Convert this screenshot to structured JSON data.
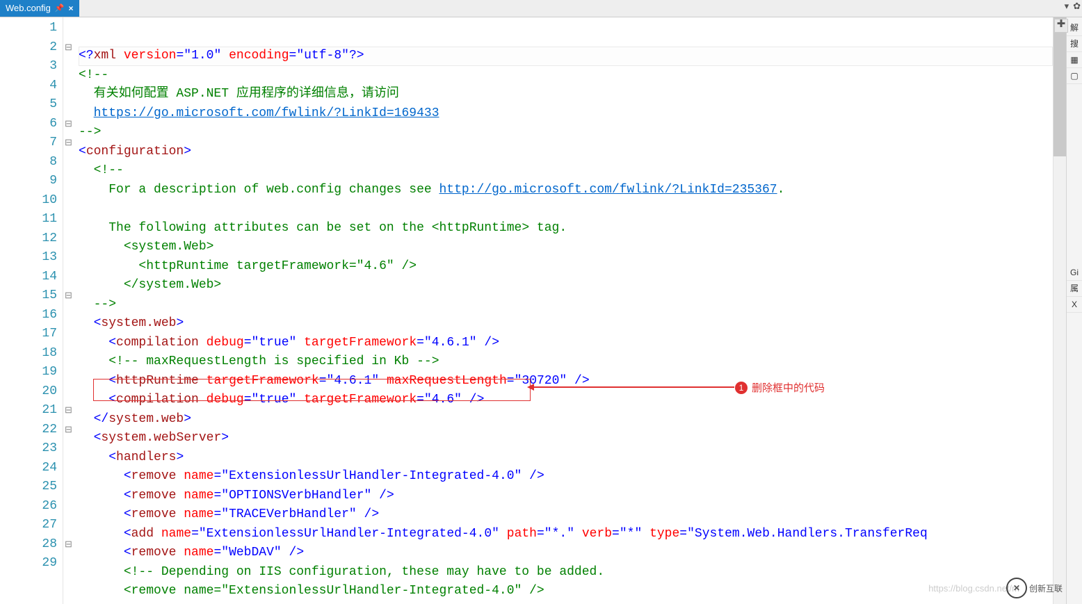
{
  "tab": {
    "title": "Web.config",
    "pin_glyph": "📌",
    "close_glyph": "×"
  },
  "sidebar_labels": {
    "solution": "解",
    "search": "搜",
    "git": "Gi",
    "prop": "属",
    "xml": "X"
  },
  "annotation": {
    "badge": "1",
    "text": "删除框中的代码"
  },
  "watermark": "https://blog.csdn.net/m",
  "logo_text": "创新互联",
  "lines": [
    {
      "n": 1,
      "fold": "",
      "html": "<span class='cm-punct'>&lt;?</span><span class='cm-name'>xml</span> <span class='cm-attr'>version</span><span class='cm-punct'>=</span><span class='cm-str'>\"1.0\"</span> <span class='cm-attr'>encoding</span><span class='cm-punct'>=</span><span class='cm-str'>\"utf-8\"</span><span class='cm-punct'>?&gt;</span>",
      "cls": "cursor-line"
    },
    {
      "n": 2,
      "fold": "⊟",
      "html": "<span class='cm-comment'>&lt;!--</span>"
    },
    {
      "n": 3,
      "fold": "",
      "html": "  <span class='cm-comment'>有关如何配置 ASP.NET 应用程序的详细信息，请访问</span>"
    },
    {
      "n": 4,
      "fold": "",
      "html": "  <span class='cm-comment cm-link'>https://go.microsoft.com/fwlink/?LinkId=169433</span>"
    },
    {
      "n": 5,
      "fold": "",
      "html": "<span class='cm-comment'>--&gt;</span>"
    },
    {
      "n": 6,
      "fold": "⊟",
      "html": "<span class='cm-punct'>&lt;</span><span class='cm-name'>configuration</span><span class='cm-punct'>&gt;</span>"
    },
    {
      "n": 7,
      "fold": "⊟",
      "html": "  <span class='cm-comment'>&lt;!--</span>"
    },
    {
      "n": 8,
      "fold": "",
      "html": "    <span class='cm-comment'>For a description of web.config changes see </span><span class='cm-comment cm-link'>http://go.microsoft.com/fwlink/?LinkId=235367</span><span class='cm-comment'>.</span>"
    },
    {
      "n": 9,
      "fold": "",
      "html": ""
    },
    {
      "n": 10,
      "fold": "",
      "html": "    <span class='cm-comment'>The following attributes can be set on the &lt;httpRuntime&gt; tag.</span>"
    },
    {
      "n": 11,
      "fold": "",
      "html": "      <span class='cm-comment'>&lt;system.Web&gt;</span>"
    },
    {
      "n": 12,
      "fold": "",
      "html": "        <span class='cm-comment'>&lt;httpRuntime targetFramework=\"4.6\" /&gt;</span>"
    },
    {
      "n": 13,
      "fold": "",
      "html": "      <span class='cm-comment'>&lt;/system.Web&gt;</span>"
    },
    {
      "n": 14,
      "fold": "",
      "html": "  <span class='cm-comment'>--&gt;</span>"
    },
    {
      "n": 15,
      "fold": "⊟",
      "html": "  <span class='cm-punct'>&lt;</span><span class='cm-name'>system.web</span><span class='cm-punct'>&gt;</span>"
    },
    {
      "n": 16,
      "fold": "",
      "html": "    <span class='cm-punct'>&lt;</span><span class='cm-name'>compilation</span> <span class='cm-attr'>debug</span><span class='cm-punct'>=</span><span class='cm-str'>\"true\"</span> <span class='cm-attr'>targetFramework</span><span class='cm-punct'>=</span><span class='cm-str'>\"4.6.1\"</span> <span class='cm-punct'>/&gt;</span>"
    },
    {
      "n": 17,
      "fold": "",
      "html": "    <span class='cm-comment'>&lt;!-- maxRequestLength is specified in Kb --&gt;</span>"
    },
    {
      "n": 18,
      "fold": "",
      "html": "    <span class='cm-punct'>&lt;</span><span class='cm-name'>httpRuntime</span> <span class='cm-attr'>targetFramework</span><span class='cm-punct'>=</span><span class='cm-str'>\"4.6.1\"</span> <span class='cm-attr'>maxRequestLength</span><span class='cm-punct'>=</span><span class='cm-str'>\"30720\"</span> <span class='cm-punct'>/&gt;</span>"
    },
    {
      "n": 19,
      "fold": "",
      "html": "    <span class='cm-punct'>&lt;</span><span class='cm-name'>compilation</span> <span class='cm-attr'>debug</span><span class='cm-punct'>=</span><span class='cm-str'>\"true\"</span> <span class='cm-attr'>targetFramework</span><span class='cm-punct'>=</span><span class='cm-str'>\"4.6\"</span> <span class='cm-punct'>/&gt;</span>"
    },
    {
      "n": 20,
      "fold": "",
      "html": "  <span class='cm-punct'>&lt;/</span><span class='cm-name'>system.web</span><span class='cm-punct'>&gt;</span>"
    },
    {
      "n": 21,
      "fold": "⊟",
      "html": "  <span class='cm-punct'>&lt;</span><span class='cm-name'>system.webServer</span><span class='cm-punct'>&gt;</span>"
    },
    {
      "n": 22,
      "fold": "⊟",
      "html": "    <span class='cm-punct'>&lt;</span><span class='cm-name'>handlers</span><span class='cm-punct'>&gt;</span>"
    },
    {
      "n": 23,
      "fold": "",
      "html": "      <span class='cm-punct'>&lt;</span><span class='cm-name'>remove</span> <span class='cm-attr'>name</span><span class='cm-punct'>=</span><span class='cm-str'>\"ExtensionlessUrlHandler-Integrated-4.0\"</span> <span class='cm-punct'>/&gt;</span>"
    },
    {
      "n": 24,
      "fold": "",
      "html": "      <span class='cm-punct'>&lt;</span><span class='cm-name'>remove</span> <span class='cm-attr'>name</span><span class='cm-punct'>=</span><span class='cm-str'>\"OPTIONSVerbHandler\"</span> <span class='cm-punct'>/&gt;</span>"
    },
    {
      "n": 25,
      "fold": "",
      "html": "      <span class='cm-punct'>&lt;</span><span class='cm-name'>remove</span> <span class='cm-attr'>name</span><span class='cm-punct'>=</span><span class='cm-str'>\"TRACEVerbHandler\"</span> <span class='cm-punct'>/&gt;</span>"
    },
    {
      "n": 26,
      "fold": "",
      "html": "      <span class='cm-punct'>&lt;</span><span class='cm-name'>add</span> <span class='cm-attr'>name</span><span class='cm-punct'>=</span><span class='cm-str'>\"ExtensionlessUrlHandler-Integrated-4.0\"</span> <span class='cm-attr'>path</span><span class='cm-punct'>=</span><span class='cm-str'>\"*.\"</span> <span class='cm-attr'>verb</span><span class='cm-punct'>=</span><span class='cm-str'>\"*\"</span> <span class='cm-attr'>type</span><span class='cm-punct'>=</span><span class='cm-str'>\"System.Web.Handlers.TransferReq</span>"
    },
    {
      "n": 27,
      "fold": "",
      "html": "      <span class='cm-punct'>&lt;</span><span class='cm-name'>remove</span> <span class='cm-attr'>name</span><span class='cm-punct'>=</span><span class='cm-str'>\"WebDAV\"</span> <span class='cm-punct'>/&gt;</span>"
    },
    {
      "n": 28,
      "fold": "⊟",
      "html": "      <span class='cm-comment'>&lt;!-- Depending on IIS configuration, these may have to be added.</span>"
    },
    {
      "n": 29,
      "fold": "",
      "html": "      <span class='cm-comment'>&lt;remove name=\"ExtensionlessUrlHandler-Integrated-4.0\" /&gt;</span>"
    }
  ]
}
